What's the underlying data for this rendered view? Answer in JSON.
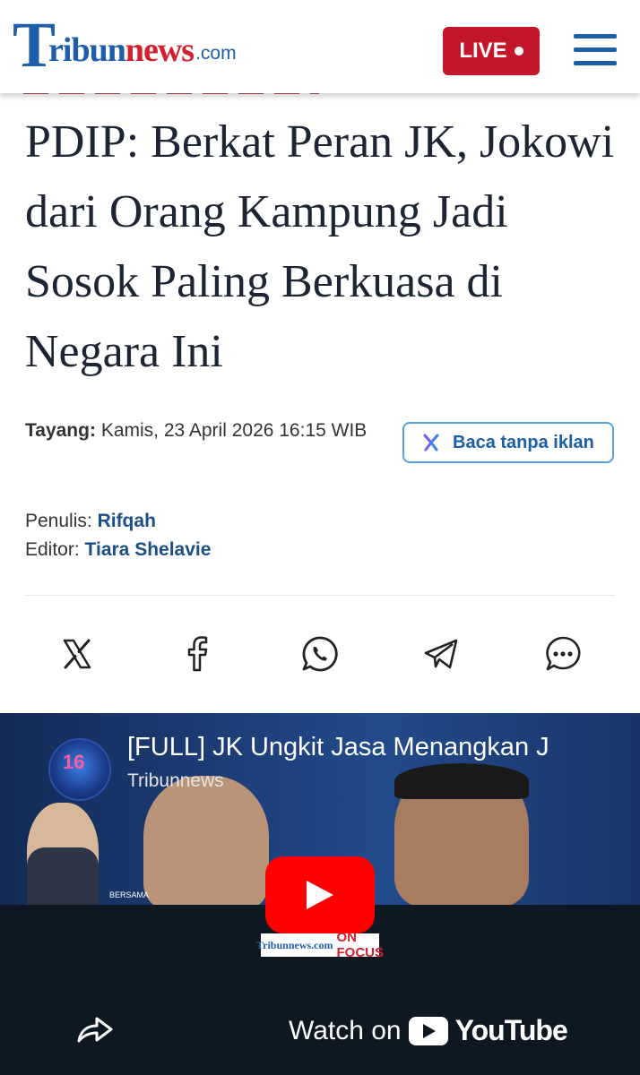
{
  "header": {
    "logo_t": "T",
    "logo_ribun": "ribun",
    "logo_news": "news",
    "logo_com": ".com",
    "live_label": "LIVE"
  },
  "article": {
    "title": "PDIP: Berkat Peran JK, Jokowi dari Orang Kampung Jadi Sosok Paling Berkuasa di Negara Ini",
    "tayang_label": "Tayang:",
    "tayang_value": "Kamis, 23 April 2026 16:15 WIB",
    "baca_label": "Baca tanpa iklan",
    "penulis_label": "Penulis:",
    "penulis_name": "Rifqah",
    "editor_label": "Editor:",
    "editor_name": "Tiara Shelavie"
  },
  "share": {
    "icons": [
      "x-icon",
      "facebook-icon",
      "whatsapp-icon",
      "telegram-icon",
      "chat-icon"
    ]
  },
  "video": {
    "title": "[FULL] JK Ungkit Jasa Menangkan J",
    "channel": "Tribunnews",
    "logo_number": "16",
    "bersama": "BERSAMA",
    "brand_tribun": "Tribunnews.com",
    "brand_onfocus": "ON FOCUS",
    "watch_label": "Watch on",
    "youtube_label": "YouTube"
  },
  "colors": {
    "brand_blue": "#1f5ea8",
    "brand_red": "#d6202f",
    "live_red": "#c4162a",
    "link_blue": "#1a4f86"
  }
}
